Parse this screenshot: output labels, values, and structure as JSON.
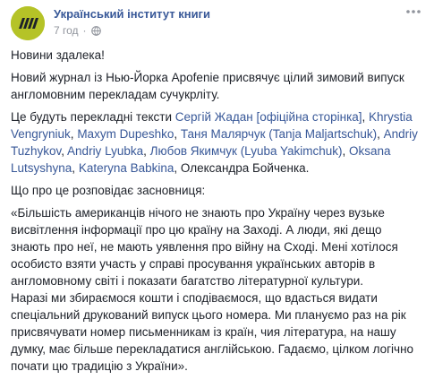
{
  "page": {
    "name": "Український інститут книги",
    "time": "7 год",
    "separator": "·"
  },
  "icons": {
    "avatar": "page-logo",
    "privacy": "globe-icon",
    "more": "more-options-icon"
  },
  "colors": {
    "link": "#385898",
    "text": "#1d2129",
    "meta": "#90949c",
    "avatar_bg": "#b5c327"
  },
  "post": {
    "p1": "Новини здалека!",
    "p2": {
      "l1": "Новий журнал із Нью-Йорка Apofenie присвячує цілий зимовий випуск",
      "l2": "англомовним перекладам сучукрліту."
    },
    "p3": {
      "l1_text": "Це будуть перекладні тексти ",
      "tag1": "Сергій Жадан [офіційна сторінка]",
      "sep1": ", ",
      "tag2": "Khrystia",
      "tag2b": "Vengryniuk",
      "sep2": ", ",
      "tag3": "Maxym Dupeshko",
      "sep3": ", ",
      "tag4": "Таня Малярчук (Tanja Maljartschuk)",
      "sep4": ", ",
      "tag5": "Andriy",
      "tag5b": "Tuzhykov",
      "sep5": ", ",
      "tag6": "Andriy Lyubka",
      "sep6": ", ",
      "tag7": "Любов Якимчук (Lyuba Yakimchuk)",
      "sep7": ", ",
      "tag8": "Oksana",
      "tag8b": "Lutsyshyna",
      "sep8": ", ",
      "tag9": "Kateryna Babkina",
      "sep9": ", Олександра Бойченка."
    },
    "p4": "Що про це розповідає засновниця:",
    "quote": [
      "«Більшість американців нічого не знають про Україну через вузьке",
      "висвітлення інформації про цю країну на Заході. А люди, які дещо",
      "знають про неї, не мають уявлення про війну на Сході. Мені хотілося",
      "особисто взяти участь у справі просування українських авторів в",
      "англомовному світі і показати багатство літературної культури.",
      "Наразі ми збираємося кошти і сподіваємося, що вдасться видати",
      "спеціальний друкований випуск цього номера. Ми плануємо раз на рік",
      "присвячувати номер письменникам із країн, чия література, на нашу",
      "думку, має більше перекладатися англійською. Гадаємо, цілком логічно",
      "почати цю традицію з України»."
    ]
  }
}
